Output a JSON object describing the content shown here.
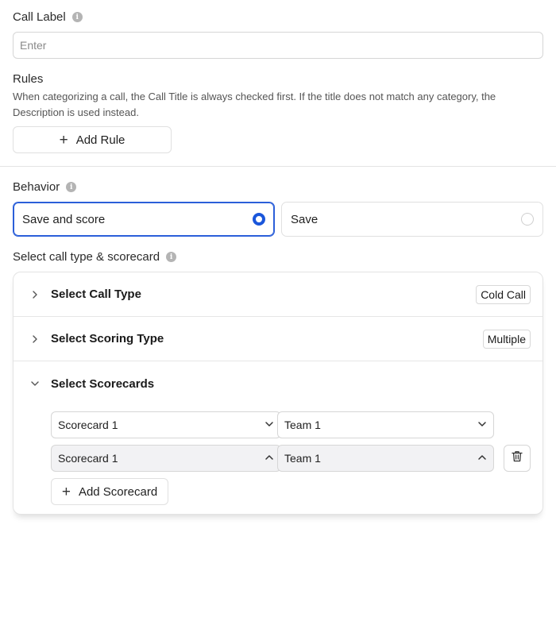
{
  "call_label": {
    "label": "Call Label",
    "placeholder": "Enter",
    "value": ""
  },
  "rules": {
    "title": "Rules",
    "description": "When categorizing a call, the Call Title is always checked first. If the title does not match any category, the Description is used instead.",
    "add_rule_label": "Add Rule"
  },
  "behavior": {
    "label": "Behavior",
    "options": [
      {
        "label": "Save and score",
        "selected": true
      },
      {
        "label": "Save",
        "selected": false
      }
    ]
  },
  "call_type_section": {
    "label": "Select call type & scorecard",
    "accordion": [
      {
        "title": "Select Call Type",
        "badge": "Cold Call",
        "expanded": false
      },
      {
        "title": "Select Scoring Type",
        "badge": "Multiple",
        "expanded": false
      },
      {
        "title": "Select Scorecards",
        "badge": "",
        "expanded": true
      }
    ],
    "scorecard_rows": [
      {
        "scorecard": "Scorecard 1",
        "team": "Team 1",
        "open": false
      },
      {
        "scorecard": "Scorecard 1",
        "team": "Team 1",
        "open": true
      }
    ],
    "add_scorecard_label": "Add Scorecard"
  },
  "colors": {
    "accent": "#1a56db",
    "border": "#d6d6d6",
    "info_icon": "#b4b4b4"
  },
  "icons": [
    "info-icon",
    "plus-icon",
    "chevron-right-icon",
    "chevron-down-icon",
    "chevron-up-icon",
    "trash-icon",
    "radio-icon"
  ]
}
